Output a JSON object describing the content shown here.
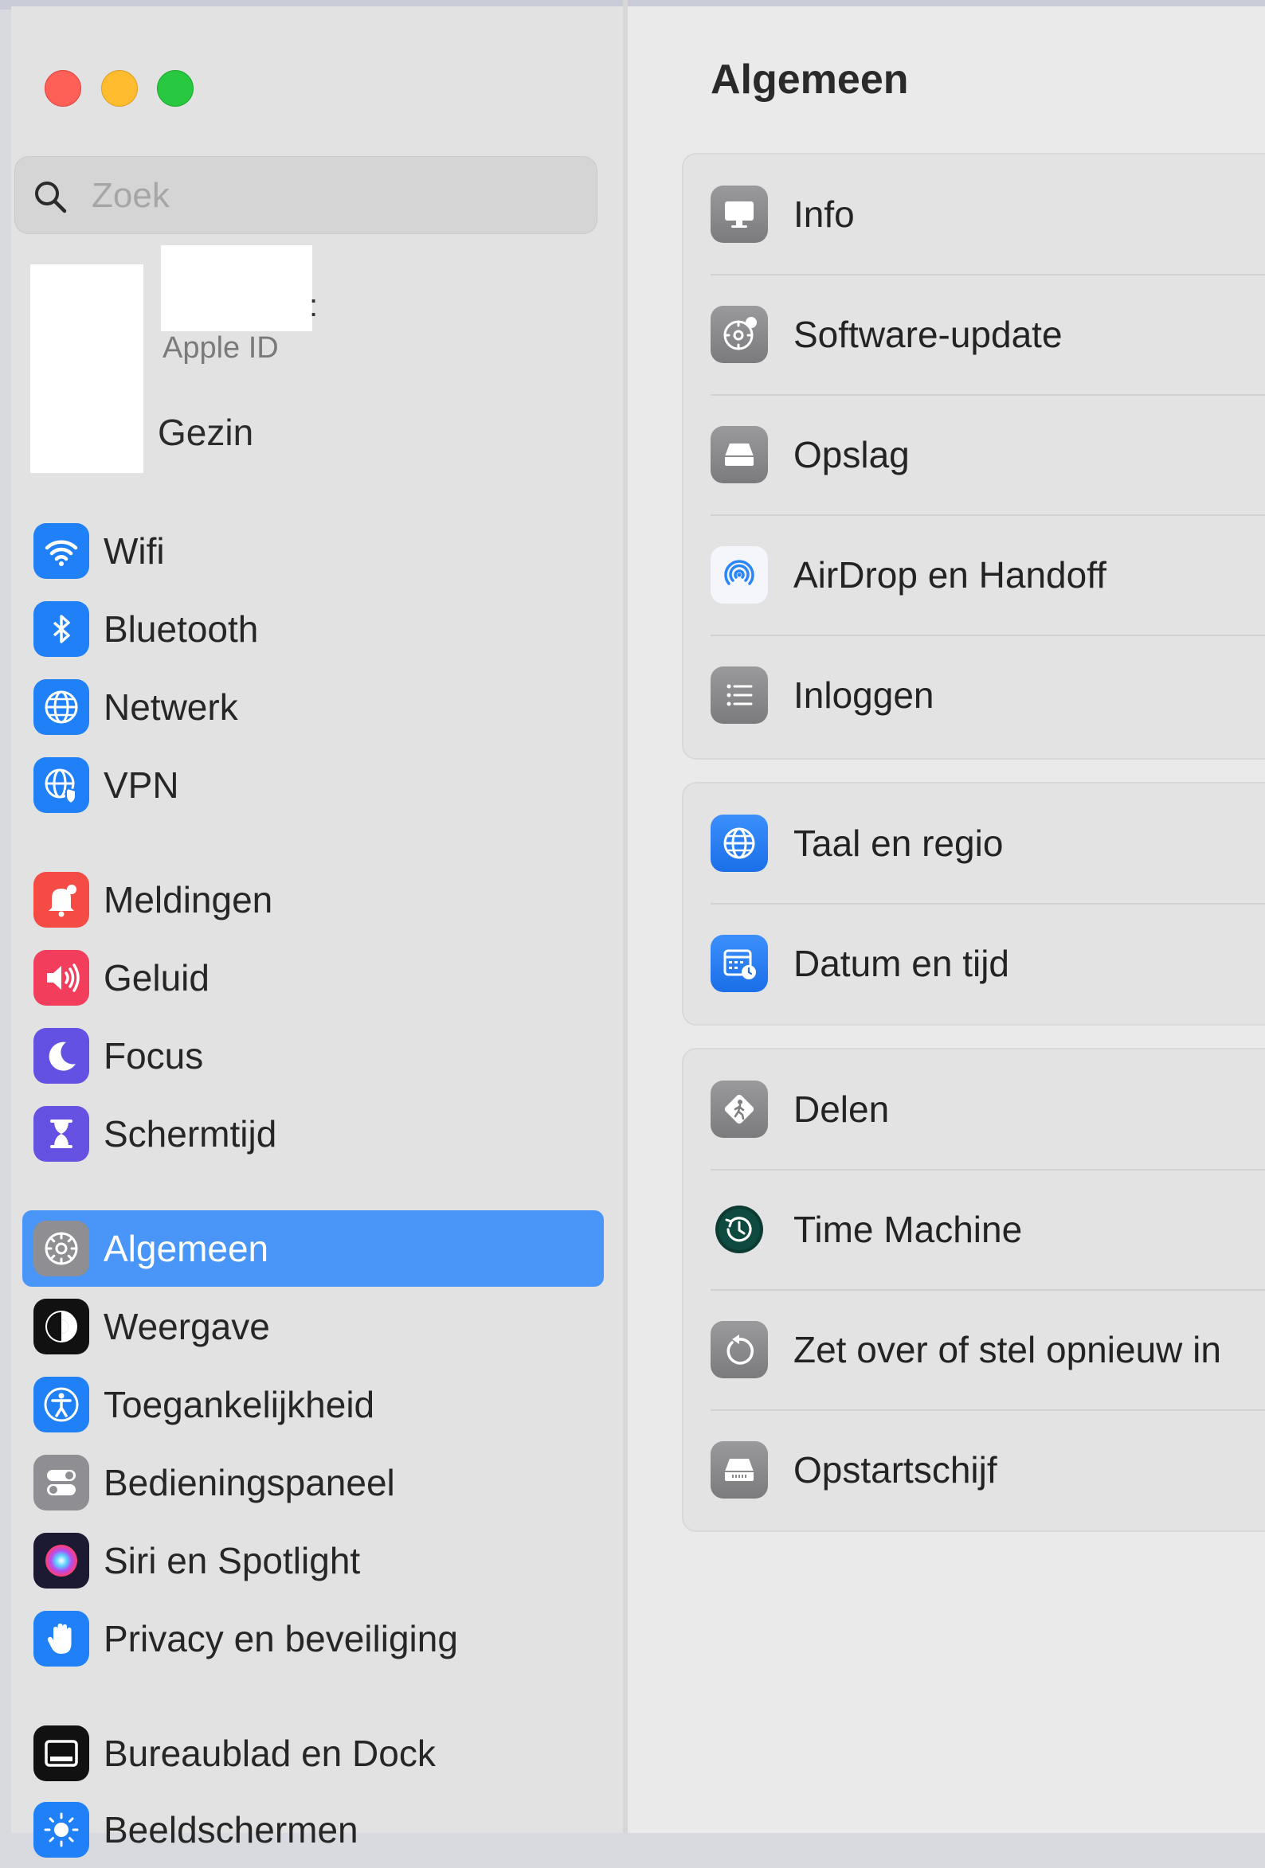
{
  "window_controls": {
    "close": "close-button",
    "minimize": "minimize-button",
    "zoom": "zoom-button"
  },
  "search": {
    "placeholder": "Zoek"
  },
  "account": {
    "apple_id_label": "Apple ID",
    "family_label": "Gezin"
  },
  "sidebar": {
    "items": [
      {
        "label": "Wifi",
        "icon": "wifi-icon",
        "color": "#1a7cf5"
      },
      {
        "label": "Bluetooth",
        "icon": "bluetooth-icon",
        "color": "#1a7cf5"
      },
      {
        "label": "Netwerk",
        "icon": "globe-icon",
        "color": "#1a7cf5"
      },
      {
        "label": "VPN",
        "icon": "vpn-globe-icon",
        "color": "#1a7cf5"
      },
      {
        "label": "Meldingen",
        "icon": "bell-icon",
        "color": "#f24a44"
      },
      {
        "label": "Geluid",
        "icon": "speaker-icon",
        "color": "#f23d5a"
      },
      {
        "label": "Focus",
        "icon": "moon-icon",
        "color": "#6150e0"
      },
      {
        "label": "Schermtijd",
        "icon": "hourglass-icon",
        "color": "#6550e0"
      },
      {
        "label": "Algemeen",
        "icon": "gear-icon",
        "color": "#8e8e93",
        "active": true
      },
      {
        "label": "Weergave",
        "icon": "appearance-icon",
        "color": "#111111"
      },
      {
        "label": "Toegankelijkheid",
        "icon": "accessibility-icon",
        "color": "#1a7cf5"
      },
      {
        "label": "Bedieningspaneel",
        "icon": "control-center-icon",
        "color": "#8e8e93"
      },
      {
        "label": "Siri en Spotlight",
        "icon": "siri-icon",
        "color": "#222244"
      },
      {
        "label": "Privacy en beveiliging",
        "icon": "hand-icon",
        "color": "#1a7cf5"
      },
      {
        "label": "Bureaublad en Dock",
        "icon": "dock-icon",
        "color": "#111111"
      },
      {
        "label": "Beeldschermen",
        "icon": "sun-icon",
        "color": "#1a7cf5"
      }
    ]
  },
  "main": {
    "title": "Algemeen",
    "groups": [
      {
        "rows": [
          {
            "label": "Info",
            "icon": "display-icon"
          },
          {
            "label": "Software-update",
            "icon": "gear-badge-icon"
          },
          {
            "label": "Opslag",
            "icon": "disk-icon"
          },
          {
            "label": "AirDrop en Handoff",
            "icon": "airdrop-icon"
          },
          {
            "label": "Inloggen",
            "icon": "list-icon"
          }
        ]
      },
      {
        "rows": [
          {
            "label": "Taal en regio",
            "icon": "globe-icon"
          },
          {
            "label": "Datum en tijd",
            "icon": "calendar-clock-icon"
          }
        ]
      },
      {
        "rows": [
          {
            "label": "Delen",
            "icon": "sharing-icon"
          },
          {
            "label": "Time Machine",
            "icon": "time-machine-icon"
          },
          {
            "label": "Zet over of stel opnieuw in",
            "icon": "reset-icon"
          },
          {
            "label": "Opstartschijf",
            "icon": "startup-disk-icon"
          }
        ]
      }
    ]
  }
}
